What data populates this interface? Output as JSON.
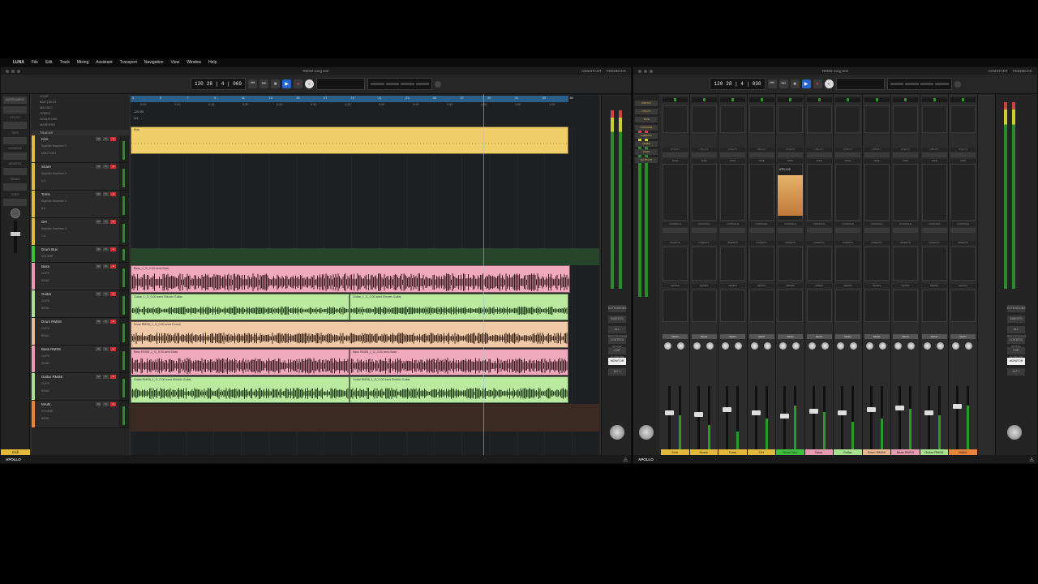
{
  "menubar": {
    "apple": "",
    "app": "LUNA",
    "items": [
      "File",
      "Edit",
      "Track",
      "Mixing",
      "Assistant",
      "Transport",
      "Navigation",
      "View",
      "Window",
      "Help"
    ]
  },
  "left_window": {
    "title": "RMS8 song test",
    "links": [
      "ASSISTANT",
      "FEEDBACK"
    ],
    "tempo": "120",
    "position": "28 | 4 | 069",
    "ruler_labels": [
      "LOOP",
      "BAR | BEAT",
      "MIN:SEC",
      "TEMPO",
      "SIGNATURE",
      "MARKERS"
    ],
    "tempo_value": "120.00",
    "signature_value": "4/4",
    "tracks_label": "TRACKS",
    "bar_ticks": [
      "3",
      "5",
      "7",
      "9",
      "11",
      "13",
      "15",
      "17",
      "19",
      "21",
      "23",
      "25",
      "27",
      "29",
      "31",
      "33",
      "35"
    ],
    "time_ticks": [
      "0:05",
      "0:10",
      "0:15",
      "0:20",
      "0:25",
      "0:30",
      "0:35",
      "0:40",
      "0:45",
      "0:50",
      "0:55",
      "1:00",
      "1:05"
    ],
    "side_label_instrument": "INSTRUMENT",
    "side_labels": [
      "UTILITY",
      "TAPE",
      "CONSOLE",
      "INSERTS",
      "SENDS",
      "CUES"
    ],
    "side_track_name": "Kick",
    "tracks": [
      {
        "name": "Kick",
        "color": "#e2b93b",
        "out": "Superior Drummer 3",
        "in": "MULTI-OUT"
      },
      {
        "name": "Snare",
        "color": "#e2b93b",
        "out": "Superior Drummer 3",
        "in": "3-4"
      },
      {
        "name": "Toms",
        "color": "#e2b93b",
        "out": "Superior Drummer 3",
        "in": "5-6"
      },
      {
        "name": "OH",
        "color": "#e2b93b",
        "out": "Superior Drummer 3",
        "in": "7-8"
      },
      {
        "name": "Drum Bus",
        "color": "#3fbf3f",
        "out": "VOLUME",
        "in": "READ"
      },
      {
        "name": "Bass",
        "color": "#e89bb0",
        "out": "CLIPS",
        "in": "READ"
      },
      {
        "name": "Guitar",
        "color": "#a8e08f",
        "out": "CLIPS",
        "in": "READ"
      },
      {
        "name": "Drum RMS8",
        "color": "#e8b892",
        "out": "CLIPS",
        "in": "READ"
      },
      {
        "name": "Bass RMS8",
        "color": "#e89bb0",
        "out": "CLIPS",
        "in": "READ"
      },
      {
        "name": "Guitar RMS8",
        "color": "#a8e08f",
        "out": "CLIPS",
        "in": "READ"
      },
      {
        "name": "MAIN",
        "color": "#e8843a",
        "out": "VOLUME",
        "in": "READ"
      }
    ],
    "clips": {
      "kick": "Kick",
      "bass": "Bass_1_G_0.00 semi  Bass",
      "guitar_a": "Guitar_1_G_0.00 semi  Electric Guitar",
      "guitar_b": "Guitar_1_G_0.00 semi  Electric Guitar",
      "drum_rms8": "Drum RMS8_1_G_0.00 semi  Drums",
      "bass_rms8_a": "Bass RMS8_1_G_0.00 semi  Bass",
      "bass_rms8_b": "Bass RMS8_1_G_0.00 semi  Bass",
      "guitar_rms8_a": "Guitar RMS8_1_G_0.00 semi  Electric Guitar",
      "guitar_rms8_b": "Guitar RMS8_1_G_0.00 semi  Electric Guitar"
    },
    "master_buttons": [
      "EXTENSIONS",
      "INSERTS",
      "ALL PROCESSING",
      "CONTROL ROOM",
      "CUE OUTPUTS",
      "MONITOR",
      "ALT 1"
    ],
    "status": {
      "apollo": "APOLLO"
    }
  },
  "right_window": {
    "title": "RMS8 song test",
    "links": [
      "ASSISTANT",
      "FEEDBACK"
    ],
    "tempo": "120",
    "position": "28 | 4 | 030",
    "left_panel_labels": [
      "INPUTS",
      "UTILITY",
      "TAPE",
      "CONSOLE",
      "INSERTS",
      "SENDS",
      "CUES",
      "OUTPUTS"
    ],
    "mid_panel_labels": [
      "POWER",
      "BYPASS",
      "COPY",
      "SET DEFAULT",
      "SCENES",
      "CONSOLE",
      "BROWSER",
      "PLUG-IN SCENES"
    ],
    "section_labels": {
      "utility": "UTILITY",
      "tape": "TAPE",
      "console": "CONSOLE",
      "inserts": "INSERTS",
      "sends": "SENDS",
      "read": "READ"
    },
    "tape_plugin": "ATR-102",
    "channels": [
      {
        "name": "Kick",
        "color": "#e2b93b"
      },
      {
        "name": "Snare",
        "color": "#e2b93b"
      },
      {
        "name": "Toms",
        "color": "#e2b93b"
      },
      {
        "name": "OH",
        "color": "#e2b93b"
      },
      {
        "name": "Drum Bus",
        "color": "#3fbf3f"
      },
      {
        "name": "Bass",
        "color": "#e89bb0"
      },
      {
        "name": "Guitar",
        "color": "#a8e08f"
      },
      {
        "name": "Drum RMS8",
        "color": "#e8b892"
      },
      {
        "name": "Bass RMS8",
        "color": "#e89bb0"
      },
      {
        "name": "Guitar RMS8",
        "color": "#a8e08f"
      },
      {
        "name": "MAIN",
        "color": "#e8843a"
      }
    ],
    "master_buttons": [
      "EXTENSIONS",
      "INSERTS",
      "ALL PROCESSING",
      "CONTROL ROOM",
      "CUE OUTPUTS",
      "MONITOR",
      "ALT 1"
    ],
    "status": {
      "apollo": "APOLLO"
    }
  },
  "colors": {
    "accent_blue": "#2266cc",
    "kick_clip": "#f0cf6a",
    "bass_clip": "#f0a9bd",
    "guitar_clip": "#b9eaa0",
    "drum_clip": "#f0c9a6"
  }
}
